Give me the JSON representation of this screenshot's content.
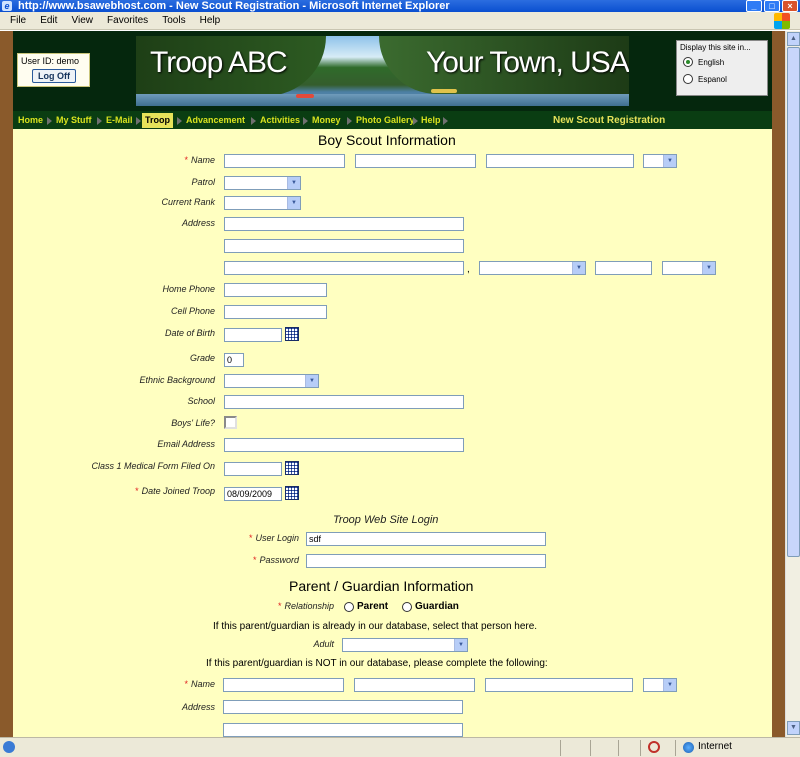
{
  "window": {
    "title": "http://www.bsawebhost.com - New Scout Registration - Microsoft Internet Explorer"
  },
  "menu": [
    "File",
    "Edit",
    "View",
    "Favorites",
    "Tools",
    "Help"
  ],
  "status": {
    "zone": "Internet"
  },
  "login": {
    "user_label": "User ID:",
    "user": "demo",
    "logoff_label": "Log Off"
  },
  "banner": {
    "left_title": "Troop ABC",
    "right_title": "Your Town, USA"
  },
  "language": {
    "title": "Display this site in...",
    "options": [
      "English",
      "Espanol"
    ],
    "selected": "English"
  },
  "nav": {
    "items": [
      "Home",
      "My Stuff",
      "E-Mail",
      "Troop",
      "Advancement",
      "Activities",
      "Money",
      "Photo Gallery",
      "Help"
    ],
    "active": "Troop",
    "page_title": "New Scout Registration"
  },
  "scout": {
    "title": "Boy Scout Information",
    "labels": {
      "name": "Name",
      "patrol": "Patrol",
      "rank": "Current Rank",
      "address": "Address",
      "home_phone": "Home Phone",
      "cell_phone": "Cell Phone",
      "dob": "Date of Birth",
      "grade": "Grade",
      "ethnic": "Ethnic Background",
      "school": "School",
      "boys_life": "Boys' Life?",
      "email": "Email Address",
      "medical": "Class 1 Medical Form Filed On",
      "joined": "Date Joined Troop"
    },
    "values": {
      "grade": "0",
      "joined": "08/09/2009"
    },
    "address_sep": ","
  },
  "login_section": {
    "title": "Troop Web Site Login",
    "labels": {
      "user": "User Login",
      "password": "Password"
    },
    "values": {
      "user": "sdf"
    }
  },
  "parent": {
    "title": "Parent / Guardian Information",
    "labels": {
      "relationship": "Relationship",
      "adult": "Adult",
      "name": "Name",
      "address": "Address"
    },
    "relationship_options": [
      "Parent",
      "Guardian"
    ],
    "text_existing": "If this parent/guardian is already in our database, select that person here.",
    "text_new": "If this parent/guardian is NOT in our database, please complete the following:"
  },
  "colors": {
    "nav_bg": "#0a3d12",
    "nav_text": "#d8e21f",
    "content_bg": "#ffffc1",
    "frame": "#8a5a2b",
    "required": "#e02020"
  }
}
